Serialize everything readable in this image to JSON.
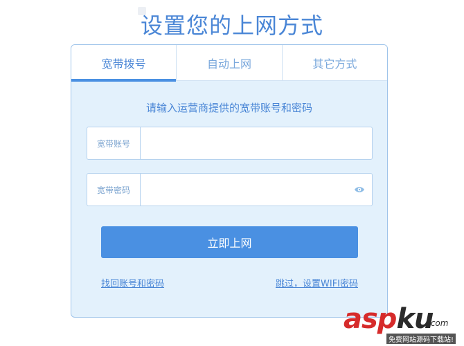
{
  "page": {
    "title": "设置您的上网方式"
  },
  "tabs": [
    {
      "label": "宽带拨号",
      "active": true
    },
    {
      "label": "自动上网",
      "active": false
    },
    {
      "label": "其它方式",
      "active": false
    }
  ],
  "form": {
    "instruction": "请输入运营商提供的宽带账号和密码",
    "account": {
      "label": "宽带账号",
      "value": "",
      "placeholder": ""
    },
    "password": {
      "label": "宽带密码",
      "value": "",
      "placeholder": ""
    },
    "submit_label": "立即上网",
    "forgot_link": "找回账号和密码",
    "skip_link": "跳过，设置WIFI密码"
  },
  "watermark": {
    "brand_part1": "asp",
    "brand_part2": "ku",
    "domain": ".com",
    "tagline": "免费网站源码下载站!"
  },
  "colors": {
    "accent": "#4a90e2",
    "text": "#4a86d6",
    "card_bg": "#e3f1fc",
    "border": "#9fc4ea"
  }
}
